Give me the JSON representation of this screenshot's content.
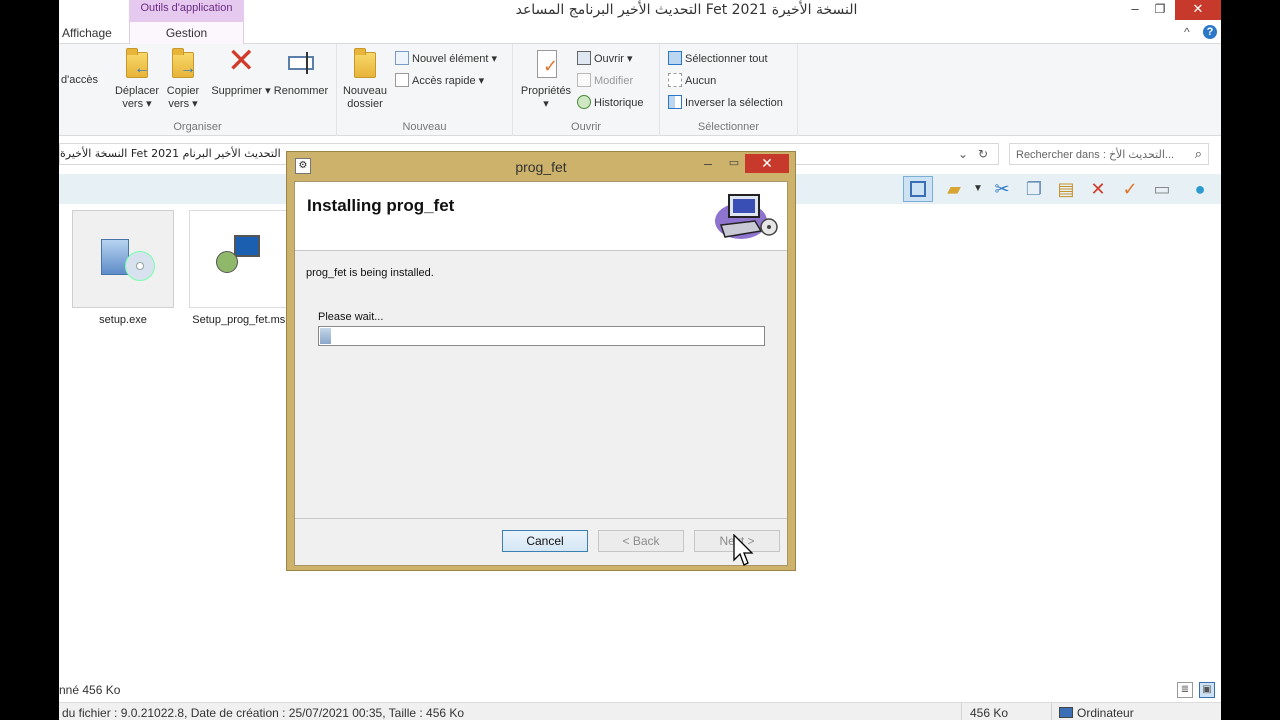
{
  "titlebar": {
    "context_tab": "Outils d'application",
    "title": "النسخة الأخيرة Fet 2021 التحديث الأخير البرنامج المساعد",
    "minimize": "–",
    "maximize": "❐",
    "close": "✕"
  },
  "tabs": {
    "affichage": "Affichage",
    "gestion": "Gestion",
    "collapse": "^",
    "help": "?"
  },
  "ribbon": {
    "organiser": {
      "label": "Organiser",
      "acces_partial": "d'accès",
      "deplacer": "Déplacer vers ▾",
      "copier": "Copier vers ▾",
      "supprimer": "Supprimer ▾",
      "renommer": "Renommer"
    },
    "nouveau": {
      "label": "Nouveau",
      "nouveau_dossier": "Nouveau dossier",
      "nouvel_element": "Nouvel élément ▾",
      "acces_rapide": "Accès rapide ▾"
    },
    "ouvrir": {
      "label": "Ouvrir",
      "proprietes": "Propriétés ▾",
      "ouvrir": "Ouvrir ▾",
      "modifier": "Modifier",
      "historique": "Historique"
    },
    "selectionner": {
      "label": "Sélectionner",
      "tout": "Sélectionner tout",
      "aucun": "Aucun",
      "inverser": "Inverser la sélection"
    }
  },
  "address": {
    "path": "النسخة الأخيرة Fet 2021 التحديث الأخير البرنام",
    "dropdown": "⌄",
    "refresh": "↻",
    "search_placeholder": "Rechercher dans : التحديث الأخ...",
    "search_icon": "⌕"
  },
  "files": [
    {
      "name": "setup.exe"
    },
    {
      "name": "Setup_prog_fet.msi"
    }
  ],
  "status": {
    "selection": "nné  456 Ko",
    "details": "du fichier : 9.0.21022.8, Date de création : 25/07/2021 00:35, Taille : 456 Ko",
    "size": "456 Ko",
    "location": "Ordinateur"
  },
  "installer": {
    "window_title": "prog_fet",
    "heading": "Installing prog_fet",
    "message": "prog_fet is being installed.",
    "wait": "Please wait...",
    "progress_percent": 2.5,
    "cancel": "Cancel",
    "back": "< Back",
    "next": "Next >",
    "minimize": "–",
    "maximize": "▭",
    "close": "✕",
    "app_icon": "⚙"
  },
  "colors": {
    "accent": "#2a78c7",
    "close_red": "#c7392a",
    "dialog_frame": "#cdb26c",
    "context_tab": "#e6c9ee"
  }
}
